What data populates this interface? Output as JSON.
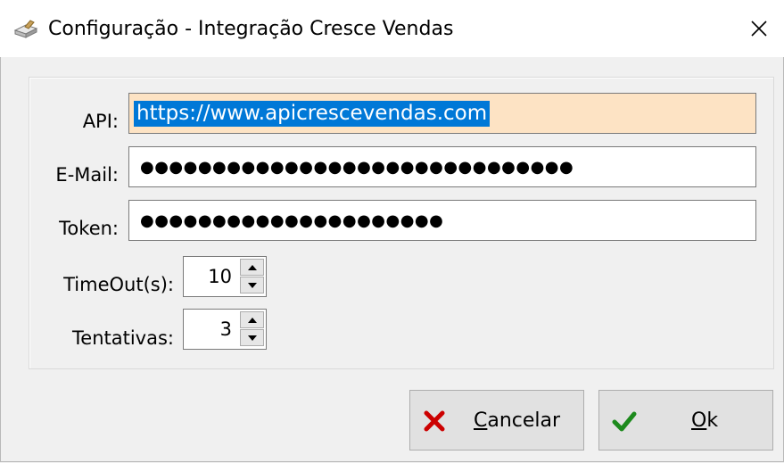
{
  "window": {
    "title": "Configuração - Integração Cresce Vendas",
    "icon": "app-icon",
    "close_icon": "close-icon"
  },
  "form": {
    "api": {
      "label": "API:",
      "value": "https://www.apicrescevendas.com"
    },
    "email": {
      "label": "E-Mail:",
      "value": "●●●●●●●●●●●●●●●●●●●●●●●●●●●●●●"
    },
    "token": {
      "label": "Token:",
      "value": "●●●●●●●●●●●●●●●●●●●●●"
    },
    "timeout": {
      "label": "TimeOut(s):",
      "value": "10"
    },
    "tentativas": {
      "label": "Tentativas:",
      "value": "3"
    }
  },
  "buttons": {
    "cancel": {
      "accel": "C",
      "rest": "ancelar",
      "icon": "x-icon"
    },
    "ok": {
      "accel": "O",
      "rest": "k",
      "icon": "check-icon"
    }
  },
  "colors": {
    "selection": "#0078d7",
    "active_field": "#fde3c4",
    "cancel_icon": "#cc0000",
    "ok_icon": "#1d8a1d"
  }
}
